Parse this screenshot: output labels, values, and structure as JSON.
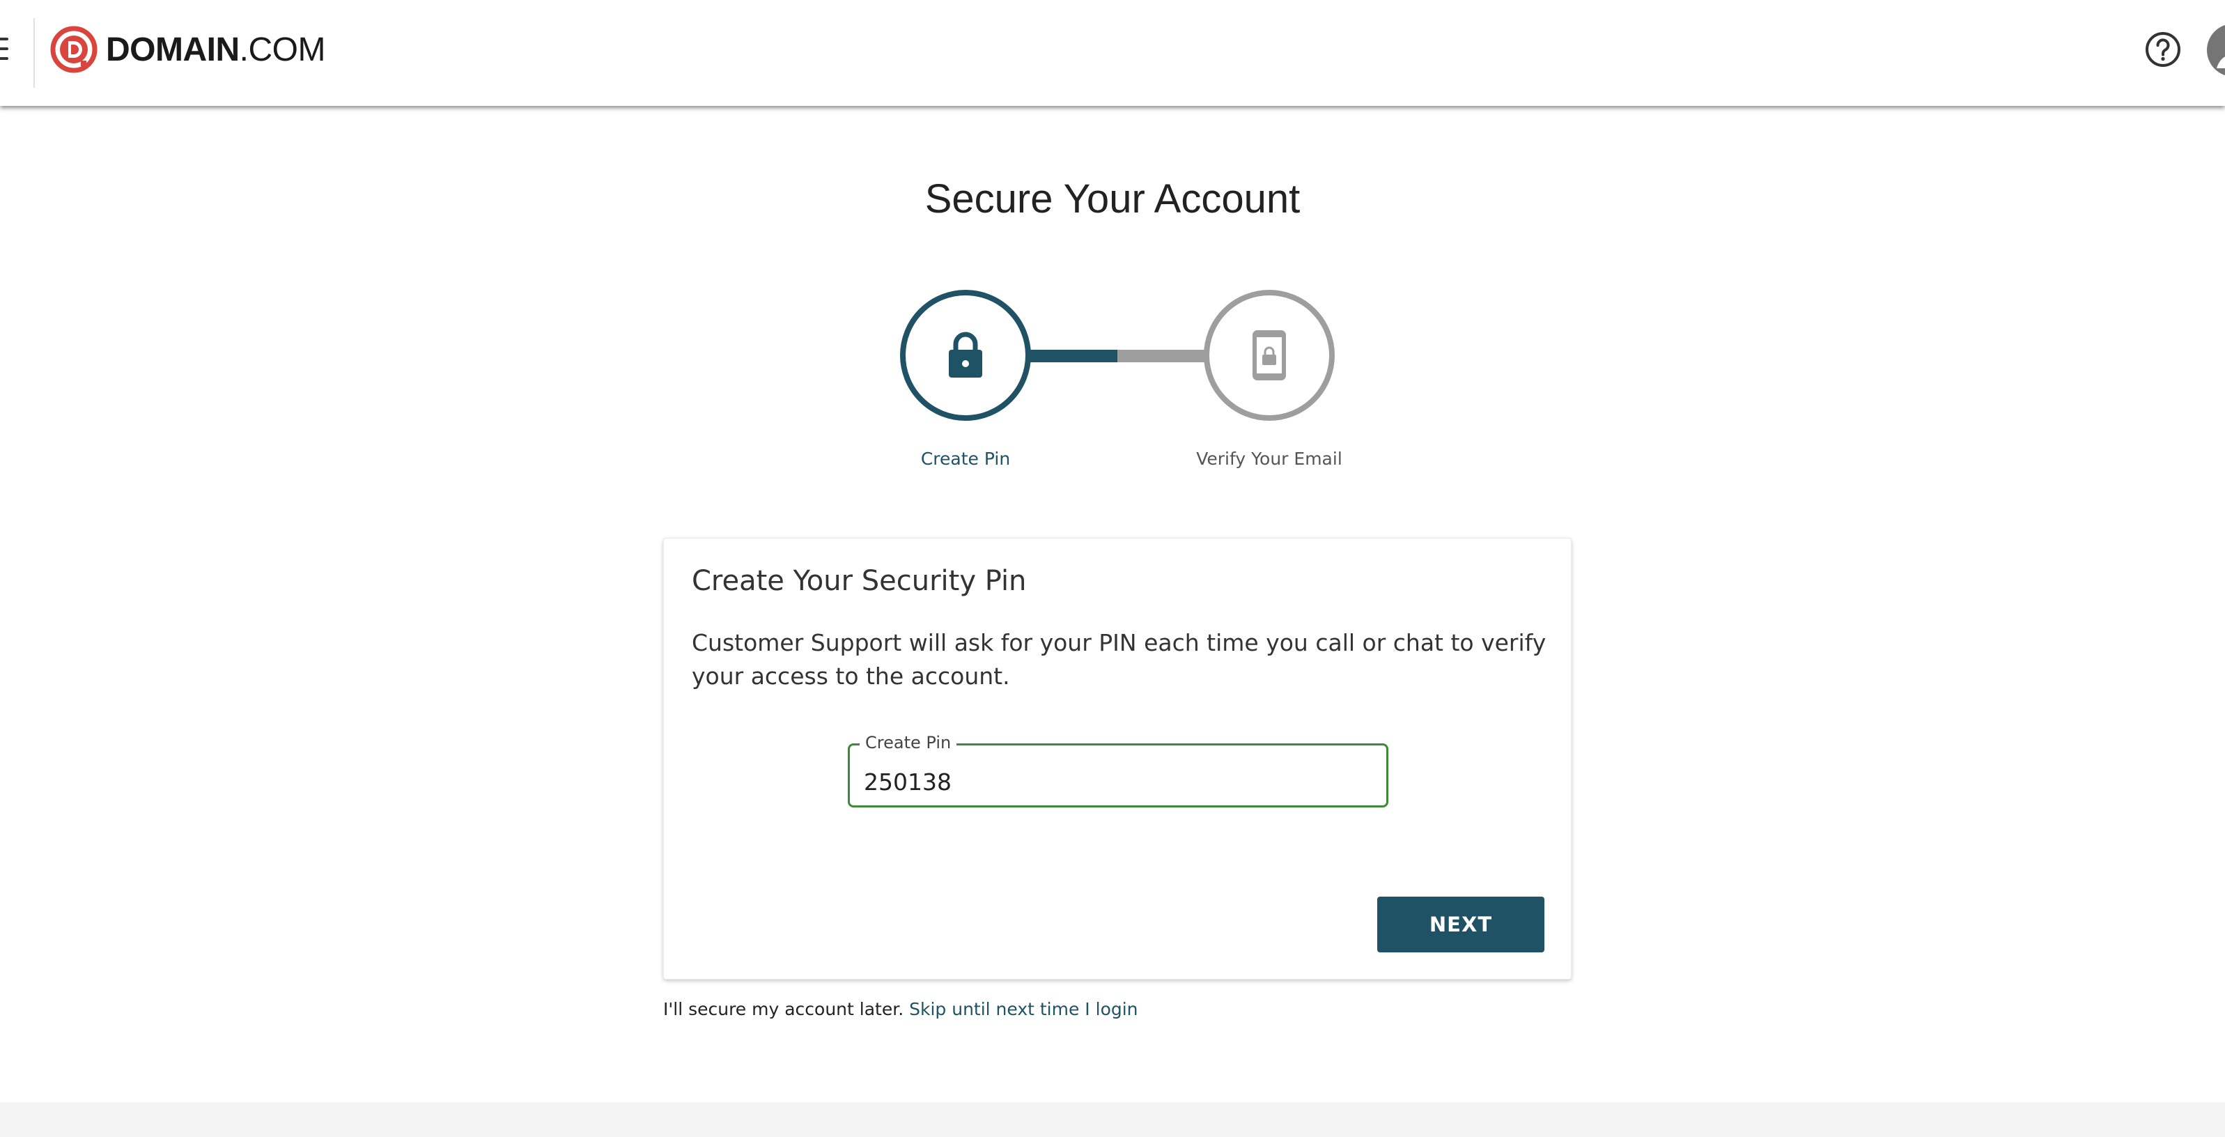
{
  "header": {
    "logo_brand": "DOMAIN",
    "logo_suffix": ".COM",
    "menu_icon": "hamburger-menu-icon",
    "help_icon": "question-circle-icon",
    "avatar_icon": "user-avatar-icon"
  },
  "page": {
    "title": "Secure Your Account"
  },
  "stepper": {
    "steps": [
      {
        "label": "Create Pin",
        "icon": "lock-icon",
        "state": "active"
      },
      {
        "label": "Verify Your Email",
        "icon": "phone-lock-icon",
        "state": "inactive"
      }
    ],
    "progress_fraction": 0.5
  },
  "card": {
    "title": "Create Your Security Pin",
    "description": "Customer Support will ask for your PIN each time you call or chat to verify your access to the account.",
    "pin_label": "Create Pin",
    "pin_value": "250138",
    "next_label": "NEXT"
  },
  "skip": {
    "text": "I'll secure my account later.",
    "link_label": "Skip until next time I login"
  },
  "colors": {
    "primary": "#1f5264",
    "inactive": "#9e9e9e",
    "valid_border": "#3e8a37",
    "logo_red": "#d9453c"
  }
}
